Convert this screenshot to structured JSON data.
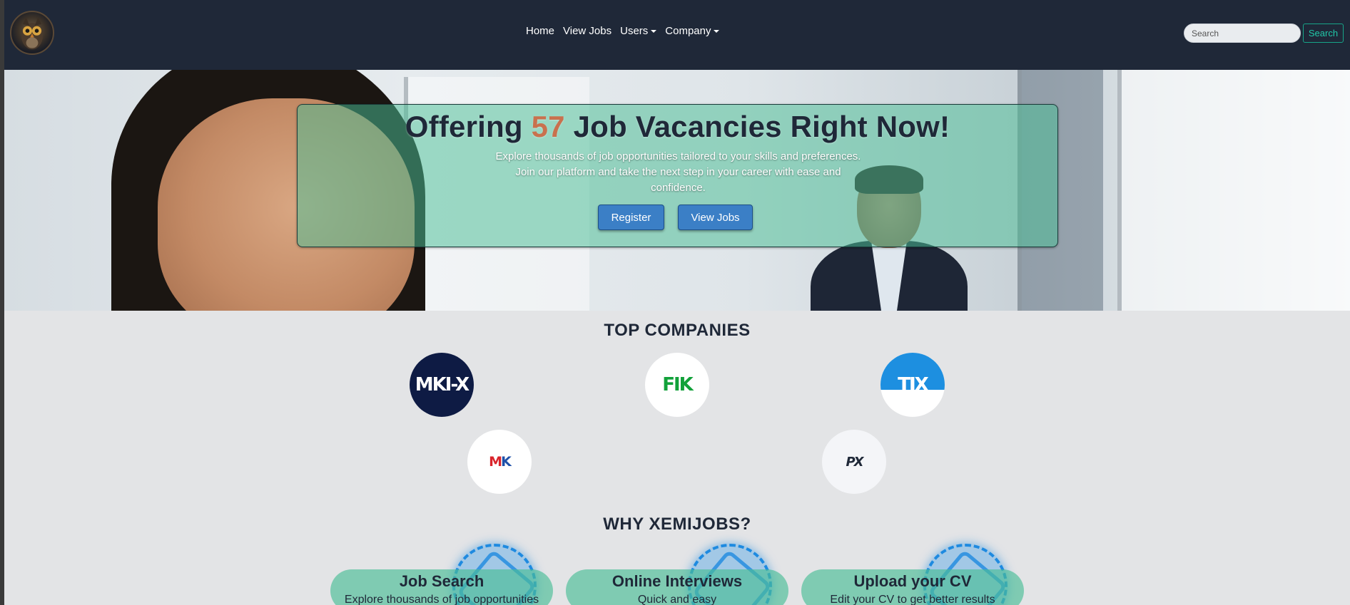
{
  "navbar": {
    "logo_icon": "owl-logo-icon",
    "links": {
      "home": "Home",
      "view_jobs": "View Jobs",
      "users": "Users",
      "company": "Company"
    },
    "search": {
      "placeholder": "Search",
      "button_label": "Search"
    }
  },
  "hero": {
    "title_prefix": "Offering ",
    "job_count": "57",
    "title_suffix": " Job Vacancies Right Now!",
    "description": "Explore thousands of job opportunities tailored to your skills and preferences. Join our platform and take the next step in your career with ease and confidence.",
    "register_label": "Register",
    "view_jobs_label": "View Jobs"
  },
  "top_companies": {
    "title": "TOP COMPANIES",
    "logos": [
      {
        "text": "MKI-X",
        "background": "#0e1b44",
        "color": "#ffffff"
      },
      {
        "text": "FIK",
        "background": "#ffffff",
        "color": "#12a13a"
      },
      {
        "text": "TIX",
        "background": "#1d8fe0",
        "color": "#ffffff"
      },
      {
        "text_m": "M",
        "text_k": "K",
        "colors": [
          "#d9242b",
          "#1e50a8"
        ]
      },
      {
        "text": "PX",
        "background": "#f4f5f8",
        "color": "#1f2838"
      }
    ]
  },
  "why": {
    "title": "WHY XEMIJOBS?",
    "features": [
      {
        "title": "Job Search",
        "description": "Explore thousands of job opportunities"
      },
      {
        "title": "Online Interviews",
        "description": "Quick and easy"
      },
      {
        "title": "Upload your CV",
        "description": "Edit your CV to get better results"
      }
    ]
  },
  "colors": {
    "navbar": "#1f2838",
    "accent_teal": "#4abd96",
    "button_blue": "#3b7fc6",
    "highlight_count": "#c9714e"
  }
}
